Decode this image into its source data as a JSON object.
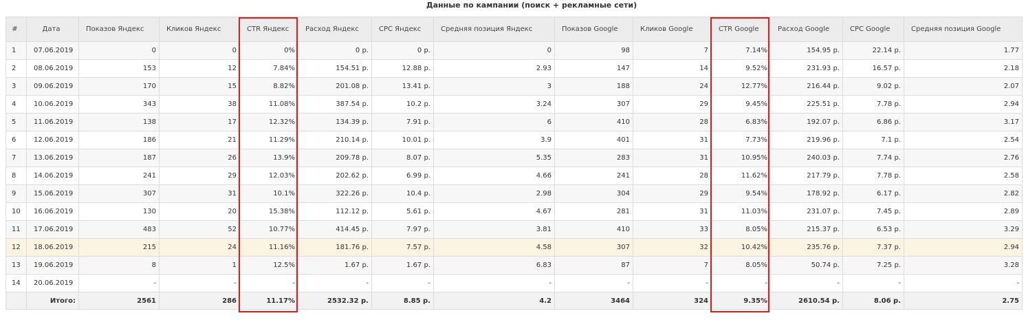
{
  "title": "Данные по кампании (поиск + рекламные сети)",
  "columns": [
    "#",
    "Дата",
    "Показов Яндекс",
    "Кликов Яндекс",
    "CTR Яндекс",
    "Расход Яндекс",
    "CPC Яндекс",
    "Средняя позиция Яндекс",
    "Показов Google",
    "Кликов Google",
    "CTR Google",
    "Расход Google",
    "CPC Google",
    "Средняя позиция Google"
  ],
  "rows": [
    [
      "1",
      "07.06.2019",
      "0",
      "0",
      "0%",
      "0 р.",
      "0 р.",
      "0",
      "98",
      "7",
      "7.14%",
      "154.95 р.",
      "22.14 р.",
      "1.77"
    ],
    [
      "2",
      "08.06.2019",
      "153",
      "12",
      "7.84%",
      "154.51 р.",
      "12.88 р.",
      "2.93",
      "147",
      "14",
      "9.52%",
      "231.93 р.",
      "16.57 р.",
      "2.18"
    ],
    [
      "3",
      "09.06.2019",
      "170",
      "15",
      "8.82%",
      "201.08 р.",
      "13.41 р.",
      "3",
      "188",
      "24",
      "12.77%",
      "216.44 р.",
      "9.02 р.",
      "2.07"
    ],
    [
      "4",
      "10.06.2019",
      "343",
      "38",
      "11.08%",
      "387.54 р.",
      "10.2 р.",
      "3.24",
      "307",
      "29",
      "9.45%",
      "225.51 р.",
      "7.78 р.",
      "2.94"
    ],
    [
      "5",
      "11.06.2019",
      "138",
      "17",
      "12.32%",
      "134.39 р.",
      "7.91 р.",
      "6",
      "410",
      "28",
      "6.83%",
      "192.07 р.",
      "6.86 р.",
      "3.17"
    ],
    [
      "6",
      "12.06.2019",
      "186",
      "21",
      "11.29%",
      "210.14 р.",
      "10.01 р.",
      "3.9",
      "401",
      "31",
      "7.73%",
      "219.96 р.",
      "7.1 р.",
      "2.54"
    ],
    [
      "7",
      "13.06.2019",
      "187",
      "26",
      "13.9%",
      "209.78 р.",
      "8.07 р.",
      "5.35",
      "283",
      "31",
      "10.95%",
      "240.03 р.",
      "7.74 р.",
      "2.76"
    ],
    [
      "8",
      "14.06.2019",
      "241",
      "29",
      "12.03%",
      "202.62 р.",
      "6.99 р.",
      "4.66",
      "241",
      "28",
      "11.62%",
      "217.79 р.",
      "7.78 р.",
      "2.58"
    ],
    [
      "9",
      "15.06.2019",
      "307",
      "31",
      "10.1%",
      "322.26 р.",
      "10.4 р.",
      "2.98",
      "304",
      "29",
      "9.54%",
      "178.92 р.",
      "6.17 р.",
      "2.82"
    ],
    [
      "10",
      "16.06.2019",
      "130",
      "20",
      "15.38%",
      "112.12 р.",
      "5.61 р.",
      "4.67",
      "281",
      "31",
      "11.03%",
      "231.07 р.",
      "7.45 р.",
      "2.89"
    ],
    [
      "11",
      "17.06.2019",
      "483",
      "52",
      "10.77%",
      "414.45 р.",
      "7.97 р.",
      "3.81",
      "410",
      "33",
      "8.05%",
      "215.37 р.",
      "6.53 р.",
      "3.29"
    ],
    [
      "12",
      "18.06.2019",
      "215",
      "24",
      "11.16%",
      "181.76 р.",
      "7.57 р.",
      "4.58",
      "307",
      "32",
      "10.42%",
      "235.76 р.",
      "7.37 р.",
      "2.94"
    ],
    [
      "13",
      "19.06.2019",
      "8",
      "1",
      "12.5%",
      "1.67 р.",
      "1.67 р.",
      "6.83",
      "87",
      "7",
      "8.05%",
      "50.74 р.",
      "7.25 р.",
      "3.28"
    ],
    [
      "14",
      "20.06.2019",
      "-",
      "-",
      "-",
      "-",
      "-",
      "-",
      "-",
      "-",
      "-",
      "-",
      "-",
      "-"
    ]
  ],
  "highlighted_row_index": 11,
  "totals": [
    "",
    "Итого:",
    "2561",
    "286",
    "11.17%",
    "2532.32 р.",
    "8.85 р.",
    "4.2",
    "3464",
    "324",
    "9.35%",
    "2610.54 р.",
    "8.06 р.",
    "2.75"
  ],
  "highlighted_columns": [
    "CTR Яндекс",
    "CTR Google"
  ],
  "colors": {
    "highlight_border": "#e11b1b",
    "header_bg": "#ececec",
    "selected_row_bg": "#fbf4e3"
  }
}
